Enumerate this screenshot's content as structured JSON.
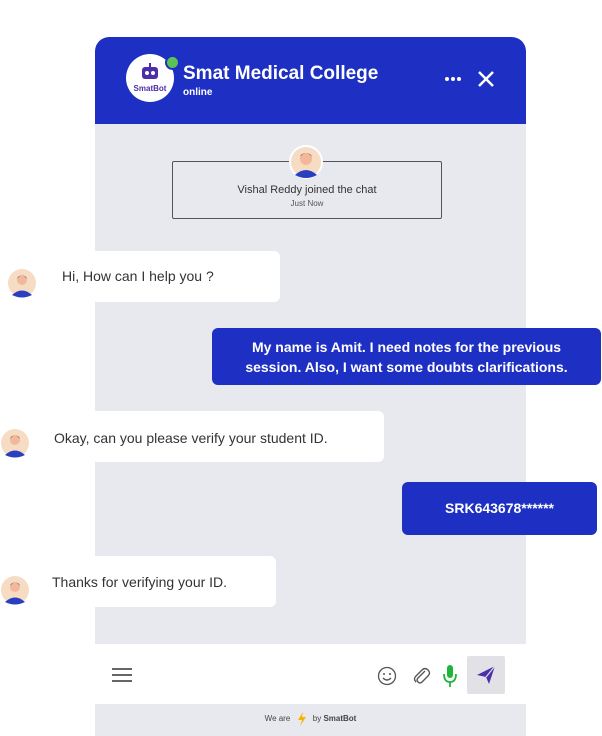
{
  "header": {
    "logo_text": "SmatBot",
    "title": "Smat Medical College",
    "status": "online"
  },
  "system": {
    "joined_text": "Vishal Reddy joined the chat",
    "joined_time": "Just Now"
  },
  "messages": [
    {
      "from": "bot",
      "text": "Hi, How can I help you ?"
    },
    {
      "from": "user",
      "line1": "My name is Amit. I need notes for the previous",
      "line2": "session. Also, I want some doubts clarifications."
    },
    {
      "from": "bot",
      "text": "Okay, can you please verify your student ID."
    },
    {
      "from": "user",
      "text": "SRK643678******"
    },
    {
      "from": "bot",
      "text": "Thanks for verifying your ID."
    }
  ],
  "composer": {
    "icons": [
      "menu-icon",
      "emoji-icon",
      "attachment-icon",
      "microphone-icon",
      "send-icon"
    ]
  },
  "footer": {
    "prefix": "We are",
    "suffix": "by",
    "brand": "SmatBot"
  },
  "colors": {
    "primary": "#1e2fc4",
    "online": "#59c454",
    "chat_bg": "#e8e9ef",
    "mic": "#1fb53a",
    "bolt": "#f4b400"
  }
}
